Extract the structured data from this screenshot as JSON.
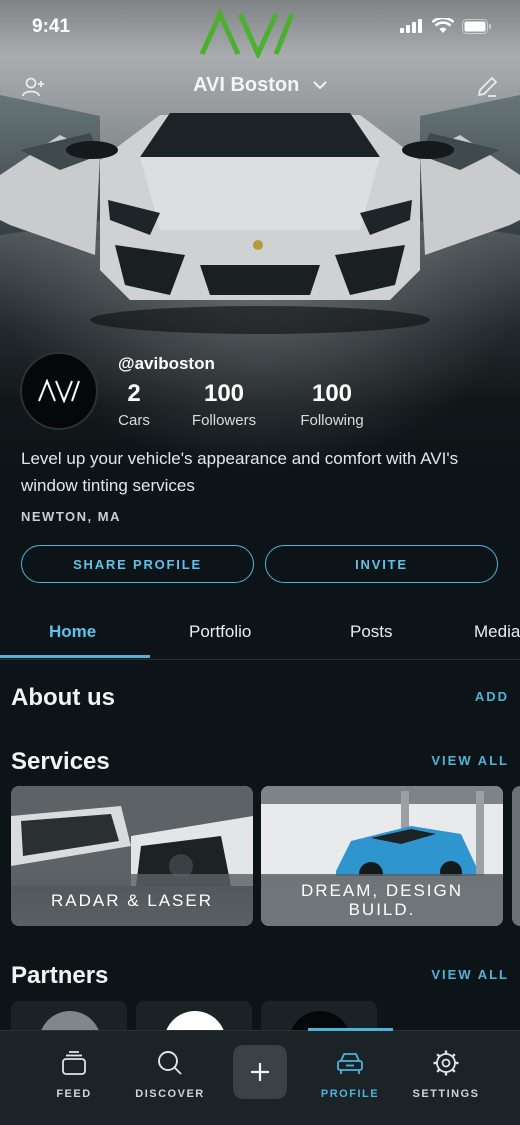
{
  "status_bar": {
    "time": "9:41"
  },
  "header": {
    "account_name": "AVI Boston"
  },
  "profile": {
    "handle": "@aviboston",
    "stats": [
      {
        "value": "2",
        "label": "Cars"
      },
      {
        "value": "100",
        "label": "Followers"
      },
      {
        "value": "100",
        "label": "Following"
      }
    ],
    "bio": "Level up your vehicle's appearance and comfort with AVI's window tinting services",
    "location": "NEWTON, MA"
  },
  "actions": {
    "share_label": "SHARE PROFILE",
    "invite_label": "INVITE"
  },
  "tabs": [
    {
      "label": "Home",
      "active": true
    },
    {
      "label": "Portfolio",
      "active": false
    },
    {
      "label": "Posts",
      "active": false
    },
    {
      "label": "Media",
      "active": false
    }
  ],
  "about": {
    "title": "About us",
    "link": "ADD"
  },
  "services": {
    "title": "Services",
    "link": "VIEW ALL",
    "items": [
      {
        "label": "RADAR & LASER"
      },
      {
        "label": "DREAM, DESIGN BUILD."
      }
    ]
  },
  "partners": {
    "title": "Partners",
    "link": "VIEW ALL"
  },
  "bottom_nav": [
    {
      "label": "FEED",
      "icon": "feed-icon"
    },
    {
      "label": "DISCOVER",
      "icon": "search-icon"
    },
    {
      "label": "",
      "icon": "plus-icon"
    },
    {
      "label": "PROFILE",
      "icon": "car-icon",
      "active": true
    },
    {
      "label": "SETTINGS",
      "icon": "gear-icon"
    }
  ],
  "colors": {
    "accent": "#4fb3d9",
    "logo_green": "#4caf2f",
    "background": "#0d1418"
  }
}
